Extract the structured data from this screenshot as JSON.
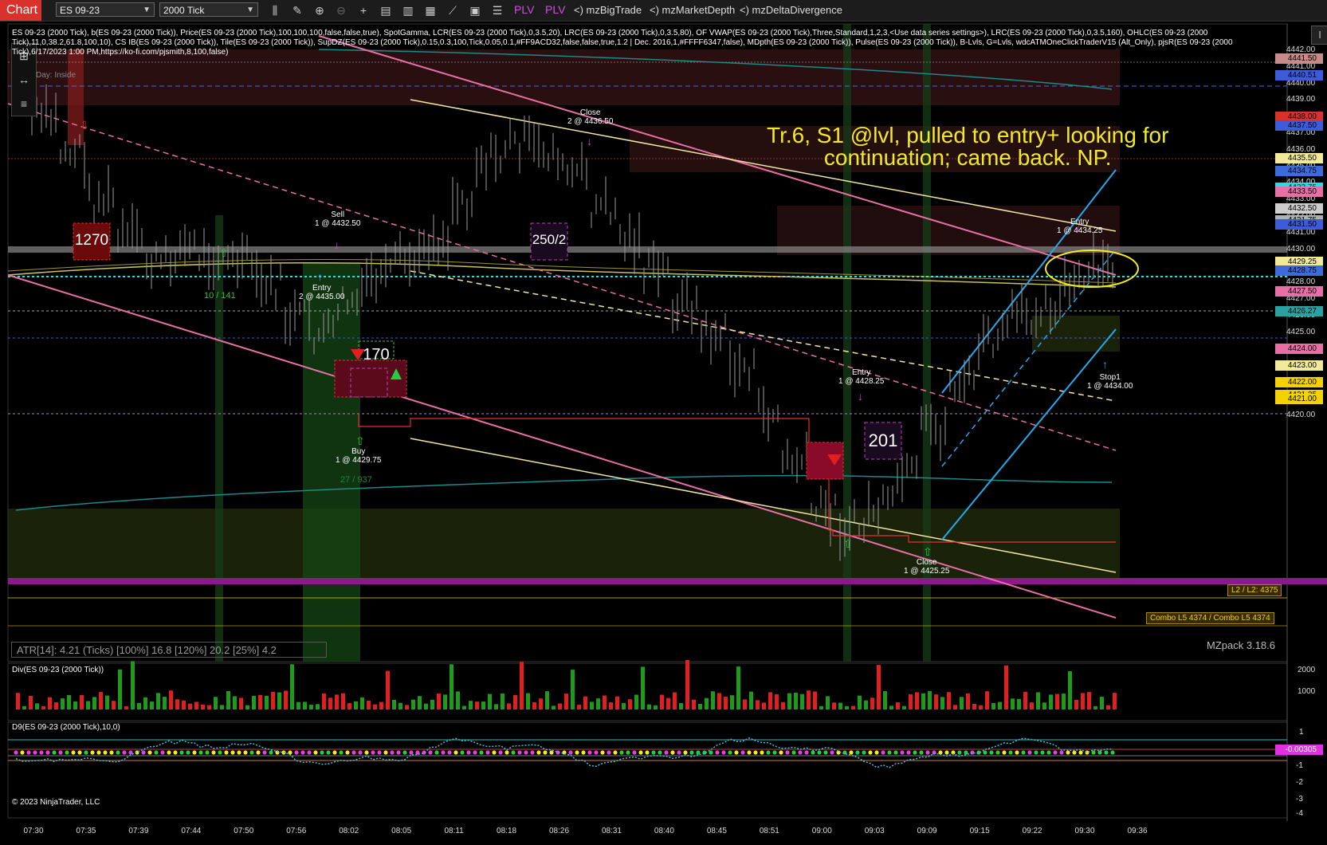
{
  "toolbar": {
    "chart_tab": "Chart",
    "instrument": "ES 09-23",
    "interval": "2000 Tick",
    "plv1": "PLV",
    "plv2": "PLV",
    "link1": "<) mzBigTrade",
    "link2": "<) mzMarketDepth",
    "link3": "<) mzDeltaDivergence"
  },
  "chart": {
    "indicator_line": "ES 09-23 (2000 Tick), b(ES 09-23 (2000 Tick)), Price(ES 09-23 (2000 Tick),100,100,100,false,false,true), SpotGamma, LCR(ES 09-23 (2000 Tick),0,3.5,20), LRC(ES 09-23 (2000 Tick),0,3.5,80), OF VWAP(ES 09-23 (2000 Tick),Three,Standard,1,2,3,<Use data series settings>), LRC(ES 09-23 (2000 Tick),0,3.5,160), OHLC(ES 09-23 (2000 Tick),11,0,38.2,61.8,100,10), CS IB(ES 09-23 (2000 Tick)), Tile(ES 09-23 (2000 Tick)), SupDZ(ES 09-23 (2000 Tick),0.15,0.3,100,Tick,0.05,0.1,#FF9ACD32,false,false,true,1.2 | Dec. 2016,1,#FFFF6347,false), MDpth(ES 09-23 (2000 Tick)), Pulse(ES 09-23 (2000 Tick)), B-Lvls, G=Lvls, wdcATMOneClickTraderV15 (Alt_Only), pjsR(ES 09-23 (2000 Tick),6/17/2023 1:00 PM,https://ko-fi.com/pjsmith,8,100,false)",
    "day_inside": "Day: Inside",
    "annotation_line1": "Tr.6, S1 @lvl, pulled to entry+  looking for",
    "annotation_line2": "continuation; came back. NP.",
    "boxes": [
      "1270",
      "250/2",
      "201",
      "170"
    ],
    "trades": [
      {
        "title": "Sell",
        "detail": "1 @ 4432.50"
      },
      {
        "title": "Entry",
        "detail": "2 @ 4435.00"
      },
      {
        "title": "Buy",
        "detail": "1 @ 4429.75"
      },
      {
        "title": "Close",
        "detail": "2 @ 4436.50"
      },
      {
        "title": "Entry",
        "detail": "1 @ 4428.25"
      },
      {
        "title": "Close",
        "detail": "1 @ 4425.25"
      },
      {
        "title": "Entry",
        "detail": "1 @ 4434.25"
      },
      {
        "title": "Stop1",
        "detail": "1 @ 4434.00"
      }
    ],
    "green_labels": [
      "10 / 141",
      "27 / 937"
    ],
    "atr": "ATR[14]: 4.21 (Ticks) [100%] 16.8  [120%] 20.2  [25%] 4.2",
    "mzpack": "MZpack 3.18.6",
    "l2_label": "L2 / L2: 4375",
    "combo_label": "Combo L5 4374 / Combo L5 4374"
  },
  "price_axis": {
    "ticks": [
      "4442.00",
      "4441.00",
      "4440.00",
      "4439.00",
      "4438.00",
      "4437.00",
      "4436.00",
      "4435.00",
      "4434.00",
      "4433.00",
      "4432.00",
      "4431.00",
      "4430.00",
      "4429.00",
      "4428.00",
      "4427.00",
      "4426.00",
      "4425.00",
      "4424.00",
      "4423.00",
      "4422.00",
      "4421.00",
      "4420.00"
    ],
    "tags": [
      {
        "text": "4441.50",
        "color": "#c98a8a"
      },
      {
        "text": "4440.51",
        "color": "#3d5bd9"
      },
      {
        "text": "4438.00",
        "color": "#d9322d"
      },
      {
        "text": "4437.50",
        "color": "#3d5bd9"
      },
      {
        "text": "4435.50",
        "color": "#f2ea9a"
      },
      {
        "text": "4434.75",
        "color": "#3d6bd9"
      },
      {
        "text": "4433.75",
        "color": "#22e0e0"
      },
      {
        "text": "4433.50",
        "color": "#e86fa5"
      },
      {
        "text": "4432.50",
        "color": "#cccccc"
      },
      {
        "text": "4431.75",
        "color": "#b0b0b0"
      },
      {
        "text": "4431.50",
        "color": "#3d5bd9"
      },
      {
        "text": "4429.25",
        "color": "#f2ea9a"
      },
      {
        "text": "4428.75",
        "color": "#3d6bd9"
      },
      {
        "text": "4427.50",
        "color": "#e86fa5"
      },
      {
        "text": "4426.27",
        "color": "#2aa0a0"
      },
      {
        "text": "4424.00",
        "color": "#e86fa5"
      },
      {
        "text": "4423.00",
        "color": "#f2ea9a"
      },
      {
        "text": "4422.00",
        "color": "#f2d200"
      },
      {
        "text": "4421.25",
        "color": "#f2d200"
      },
      {
        "text": "4421.00",
        "color": "#f2d200"
      }
    ]
  },
  "div_panel": {
    "title": "Div(ES 09-23 (2000 Tick))",
    "ticks": [
      "2000",
      "1000"
    ]
  },
  "d9_panel": {
    "title": "D9(ES 09-23 (2000 Tick),10,0)",
    "ticks": [
      "1",
      "-1",
      "-2",
      "-3",
      "-4"
    ],
    "tag": "-0.00305"
  },
  "time_axis": {
    "ticks": [
      "07:30",
      "07:35",
      "07:39",
      "07:44",
      "07:50",
      "07:56",
      "08:02",
      "08:05",
      "08:11",
      "08:18",
      "08:26",
      "08:31",
      "08:40",
      "08:45",
      "08:51",
      "09:00",
      "09:03",
      "09:09",
      "09:15",
      "09:22",
      "09:30",
      "09:36"
    ]
  },
  "copyright": "© 2023 NinjaTrader, LLC",
  "colors": {
    "accent": "#d9322d",
    "pink": "#e86fa5",
    "yellow": "#f2ea22",
    "cyan": "#22aaf0"
  }
}
